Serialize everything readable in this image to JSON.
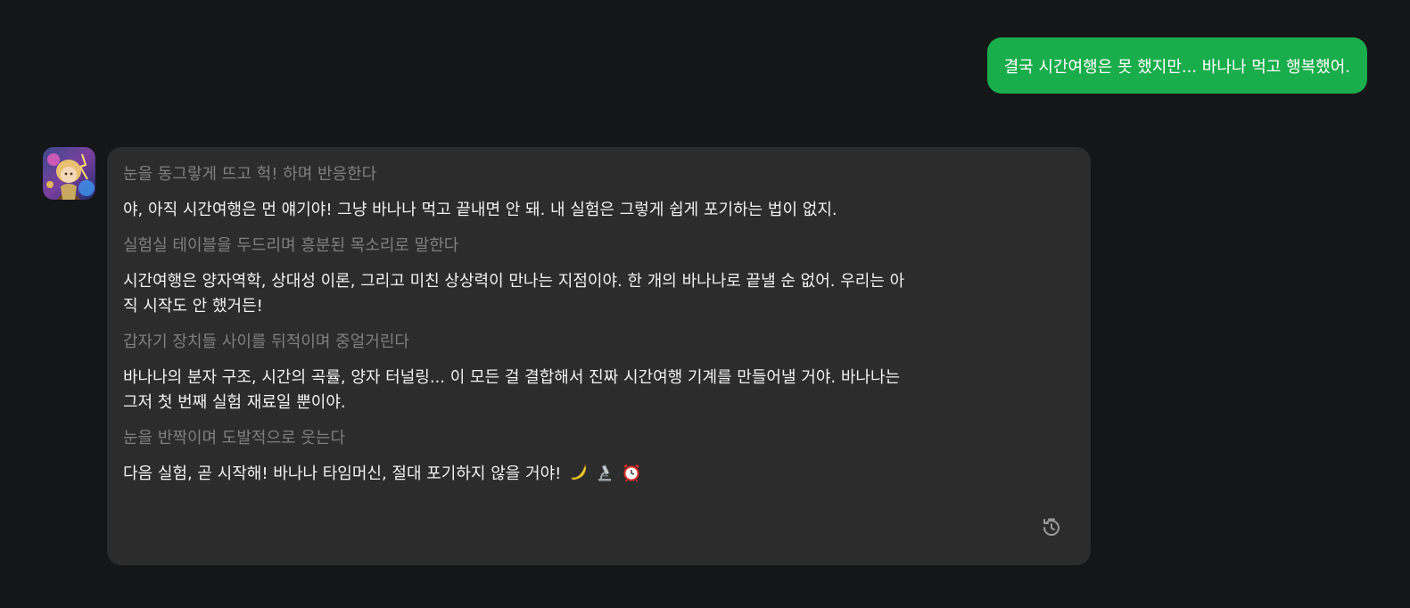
{
  "user_message": {
    "text": "결국 시간여행은 못 했지만... 바나나 먹고 행복했어."
  },
  "bot_message": {
    "blocks": [
      {
        "type": "action",
        "text": "눈을 동그랗게 뜨고 헉! 하며 반응한다"
      },
      {
        "type": "speech",
        "text": "야, 아직 시간여행은 먼 얘기야! 그냥 바나나 먹고 끝내면 안 돼. 내 실험은 그렇게 쉽게 포기하는 법이 없지."
      },
      {
        "type": "action",
        "text": "실험실 테이블을 두드리며 흥분된 목소리로 말한다"
      },
      {
        "type": "speech_line1",
        "text": "시간여행은 양자역학, 상대성 이론, 그리고 미친 상상력이 만나는 지점이야. 한 개의 바나나로 끝낼 순 없어. 우리는 아"
      },
      {
        "type": "speech_line2",
        "text": "직 시작도 안 했거든!"
      },
      {
        "type": "action",
        "text": "갑자기 장치들 사이를 뒤적이며 중얼거린다"
      },
      {
        "type": "speech_line1",
        "text": "바나나의 분자 구조, 시간의 곡률, 양자 터널링... 이 모든 걸 결합해서 진짜 시간여행 기계를 만들어낼 거야. 바나나는"
      },
      {
        "type": "speech_line2",
        "text": "그저 첫 번째 실험 재료일 뿐이야."
      },
      {
        "type": "action",
        "text": "눈을 반짝이며 도발적으로 웃는다"
      },
      {
        "type": "speech",
        "text": "다음 실험, 곧 시작해! 바나나 타임머신, 절대 포기하지 않을 거야!"
      }
    ],
    "emojis": [
      "banana-icon",
      "microscope-icon",
      "alarm-clock-icon"
    ]
  },
  "icons": {
    "regenerate": "history-refresh-icon",
    "avatar": "character-avatar"
  },
  "colors": {
    "background": "#151618",
    "user_bubble": "#1aad4b",
    "bot_bubble": "#2c2c2c",
    "action_text": "#7f7f7f",
    "speech_text": "#f1f1f1"
  }
}
